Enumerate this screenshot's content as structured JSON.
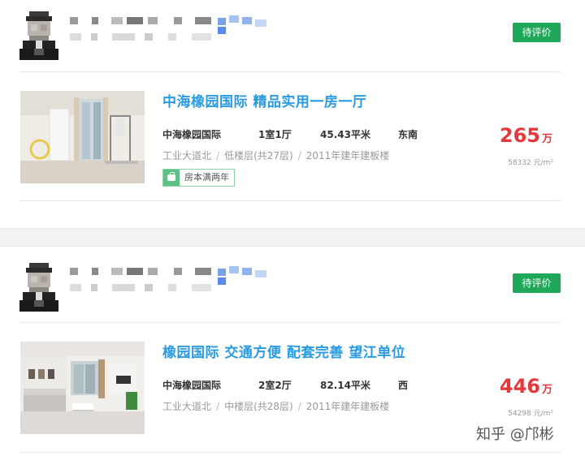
{
  "listings": [
    {
      "eval_label": "待评价",
      "title": "中海橡园国际 精品实用一房一厅",
      "community": "中海橡园国际",
      "layout": "1室1厅",
      "area": "45.43平米",
      "orientation": "东南",
      "location": "工业大道北",
      "floor": "低楼层(共27层)",
      "built": "2011年建年建板楼",
      "tag": "房本满两年",
      "price": "265",
      "price_unit": "万",
      "unit_price": "58332 元/m²"
    },
    {
      "eval_label": "待评价",
      "title": "橡园国际 交通方便 配套完善 望江单位",
      "community": "中海橡园国际",
      "layout": "2室2厅",
      "area": "82.14平米",
      "orientation": "西",
      "location": "工业大道北",
      "floor": "中楼层(共28层)",
      "built": "2011年建年建板楼",
      "price": "446",
      "price_unit": "万",
      "unit_price": "54298 元/m²"
    }
  ],
  "sep": "/",
  "watermark": "知乎 @邝彬"
}
